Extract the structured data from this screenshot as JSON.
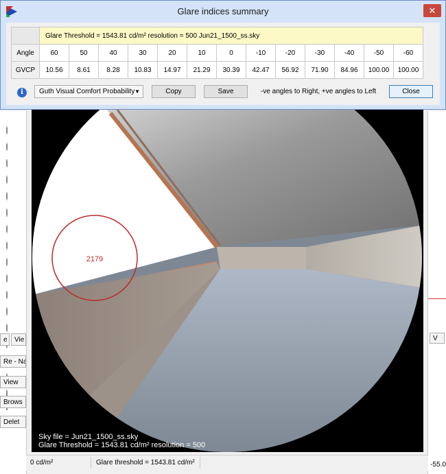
{
  "dialog": {
    "title": "Glare indices summary",
    "close_glyph": "✕",
    "info_line": "Glare Threshold = 1543.81 cd/m²     resolution = 500     Jun21_1500_ss.sky",
    "angle_label": "Angle",
    "gvcp_label": "GVCP",
    "angles": [
      "60",
      "50",
      "40",
      "30",
      "20",
      "10",
      "0",
      "-10",
      "-20",
      "-30",
      "-40",
      "-50",
      "-60"
    ],
    "gvcp": [
      "10.56",
      "8.61",
      "8.28",
      "10.83",
      "14.97",
      "21.29",
      "30.39",
      "42.47",
      "56.92",
      "71.90",
      "84.96",
      "100.00",
      "100.00"
    ],
    "index_select": "Guth Visual Comfort Probability",
    "copy_label": "Copy",
    "save_label": "Save",
    "hint": "-ve angles to Right,  +ve angles to Left",
    "close_label": "Close"
  },
  "render": {
    "glare_value": "2179",
    "sky_file": "Sky file = Jun21_1500_ss.sky",
    "glare_line": "Glare Threshold = 1543.81 cd/m²  resolution = 500"
  },
  "status": {
    "left": "0 cd/m²",
    "right": "Glare threshold = 1543.81 cd/m²"
  },
  "background": {
    "tab1": "e",
    "tab2": "Vie",
    "tab3": "Re - Na",
    "view_btn": "View",
    "browse_btn": "Brows",
    "delete_btn": "Delet",
    "right_tab": "V",
    "right_value": "-55.0"
  },
  "colors": {
    "title_bg": "#d4e3f7",
    "info_row": "#fcf9c6",
    "close_red": "#c7473d",
    "circle": "#c0292b"
  }
}
